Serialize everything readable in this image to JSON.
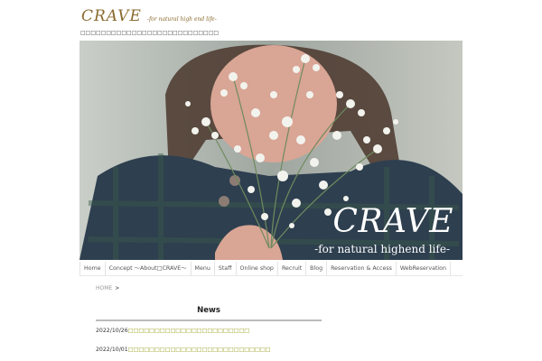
{
  "brand": {
    "logo": "CRAVE",
    "tagline": "-for natural high end life-",
    "site_description": "□□□□□□□□□□□□□□□□□□□□□□□□□□□"
  },
  "hero": {
    "title": "CRAVE",
    "subtitle": "-for natural highend life-"
  },
  "nav": {
    "items": [
      {
        "label": "Home"
      },
      {
        "label": "Concept ～About□CRAVE～"
      },
      {
        "label": "Menu"
      },
      {
        "label": "Staff"
      },
      {
        "label": "Online shop"
      },
      {
        "label": "Recruit"
      },
      {
        "label": "Blog"
      },
      {
        "label": "Reservation & Access"
      },
      {
        "label": "WebReservation"
      }
    ]
  },
  "breadcrumb": {
    "home": "HOME",
    "separator": ">"
  },
  "news": {
    "title": "News",
    "items": [
      {
        "date": "2022/10/26",
        "text": "□□□□□□□□□□□□□□□□□□□□□□□"
      },
      {
        "date": "2022/10/01",
        "text": "□□□□□□□□□□□□□□□□□□□□□□□□□□□"
      }
    ]
  },
  "colors": {
    "brand": "#8a6a2e",
    "link": "#9aa01e"
  }
}
